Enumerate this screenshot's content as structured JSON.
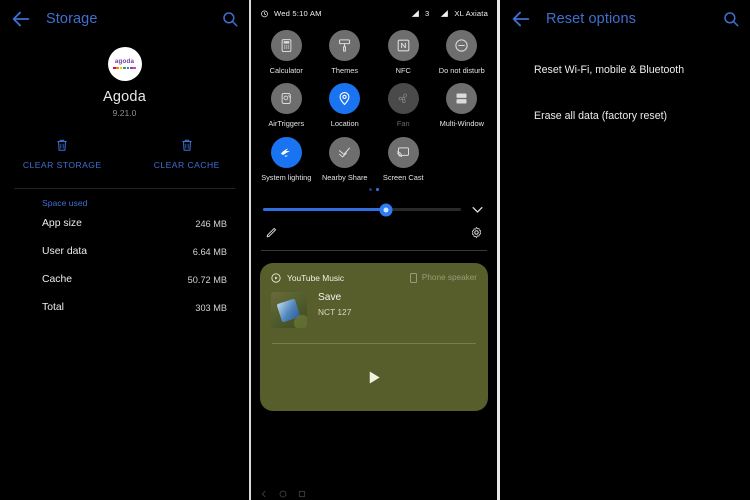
{
  "left_panel": {
    "header": {
      "title": "Storage",
      "back_icon": "arrow-back-icon",
      "search_icon": "search-icon"
    },
    "app": {
      "name": "Agoda",
      "version": "9.21.0",
      "logo_text": "agoda"
    },
    "logo_dot_colors": [
      "#e4002b",
      "#ff7a00",
      "#f5c400",
      "#1fa85c",
      "#1f7ae0",
      "#7b3fb5",
      "#d43fa0"
    ],
    "actions": [
      {
        "label": "CLEAR STORAGE",
        "icon": "trash-icon"
      },
      {
        "label": "CLEAR CACHE",
        "icon": "trash-icon"
      }
    ],
    "section_label": "Space used",
    "rows": [
      {
        "key": "App size",
        "value": "246 MB"
      },
      {
        "key": "User data",
        "value": "6.64 MB"
      },
      {
        "key": "Cache",
        "value": "50.72 MB"
      },
      {
        "key": "Total",
        "value": "303 MB"
      }
    ],
    "accent_color": "#3f6fd0"
  },
  "middle_panel": {
    "status_bar": {
      "alarm_icon": "alarm-icon",
      "datetime": "Wed 5:10 AM",
      "signal_icon_1": "signal-icon",
      "signal_count": "3",
      "signal_icon_2": "signal-icon",
      "carrier": "XL Axiata"
    },
    "quick_settings": {
      "tiles": [
        {
          "label": "Calculator",
          "icon": "calculator-icon",
          "state": "inactive"
        },
        {
          "label": "Themes",
          "icon": "themes-icon",
          "state": "inactive"
        },
        {
          "label": "NFC",
          "icon": "nfc-icon",
          "state": "inactive"
        },
        {
          "label": "Do not disturb",
          "icon": "do-not-disturb-icon",
          "state": "inactive"
        },
        {
          "label": "AirTriggers",
          "icon": "airtriggers-icon",
          "state": "inactive"
        },
        {
          "label": "Location",
          "icon": "location-pin-icon",
          "state": "active"
        },
        {
          "label": "Fan",
          "icon": "fan-icon",
          "state": "disabled"
        },
        {
          "label": "Multi-Window",
          "icon": "multi-window-icon",
          "state": "inactive"
        },
        {
          "label": "System lighting",
          "icon": "rog-logo-icon",
          "state": "active"
        },
        {
          "label": "Nearby Share",
          "icon": "nearby-share-icon",
          "state": "inactive"
        },
        {
          "label": "Screen Cast",
          "icon": "screen-cast-icon",
          "state": "inactive"
        }
      ],
      "page_dots": 2,
      "active_page": 2
    },
    "brightness": {
      "value_percent": 62,
      "slider_icon": "brightness-icon",
      "expand_icon": "chevron-down-icon"
    },
    "tools": {
      "edit_icon": "pencil-edit-icon",
      "settings_icon": "gear-icon"
    },
    "media": {
      "app_name": "YouTube Music",
      "app_icon": "youtube-music-icon",
      "output_device": "Phone speaker",
      "output_icon": "phone-speaker-icon",
      "track_title": "Save",
      "artist": "NCT 127",
      "play_icon": "play-icon",
      "card_color": "#575d2b"
    },
    "nav_bar": {
      "icons": [
        "back-icon",
        "home-icon",
        "recents-icon"
      ]
    }
  },
  "right_panel": {
    "header": {
      "title": "Reset options",
      "back_icon": "arrow-back-icon",
      "search_icon": "search-icon"
    },
    "items": [
      {
        "label": "Reset Wi-Fi, mobile & Bluetooth"
      },
      {
        "label": "Erase all data (factory reset)"
      }
    ],
    "accent_color": "#3f6fd0"
  }
}
